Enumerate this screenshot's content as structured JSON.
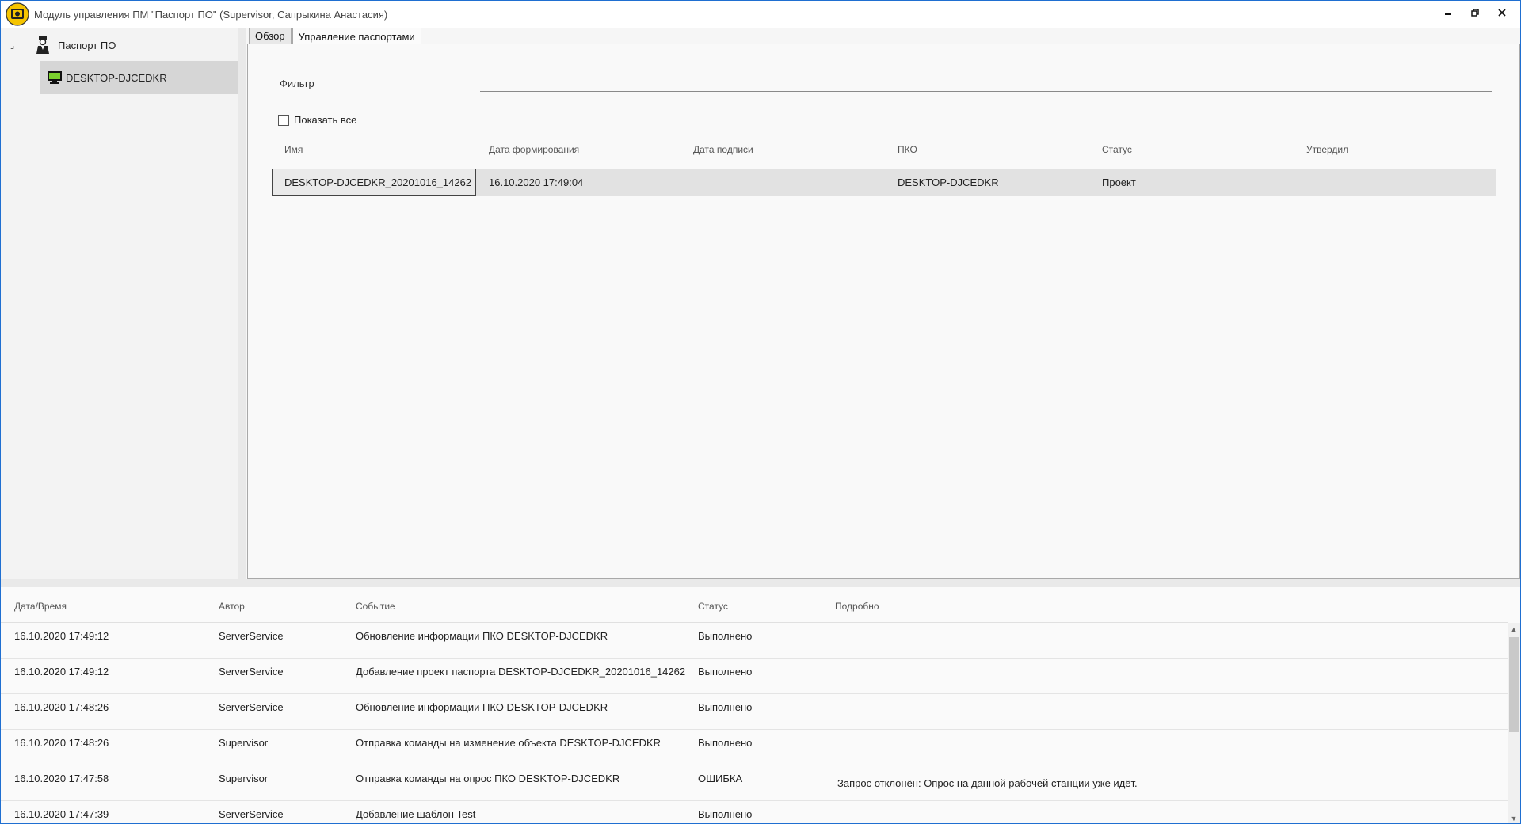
{
  "window": {
    "title": "Модуль управления ПМ \"Паспорт ПО\" (Supervisor, Сапрыкина Анастасия)"
  },
  "tree": {
    "root_label": "Паспорт ПО",
    "child_label": "DESKTOP-DJCEDKR"
  },
  "tabs": [
    {
      "label": "Обзор"
    },
    {
      "label": "Управление паспортами"
    }
  ],
  "filter": {
    "label": "Фильтр",
    "value": ""
  },
  "show_all": {
    "label": "Показать все",
    "checked": false
  },
  "passports": {
    "columns": [
      "Имя",
      "Дата формирования",
      "Дата подписи",
      "ПКО",
      "Статус",
      "Утвердил"
    ],
    "rows": [
      {
        "name": "DESKTOP-DJCEDKR_20201016_14262",
        "created": "16.10.2020 17:49:04",
        "signed": "",
        "pko": "DESKTOP-DJCEDKR",
        "status": "Проект",
        "approved_by": ""
      }
    ]
  },
  "log": {
    "columns": [
      "Дата/Время",
      "Автор",
      "Событие",
      "Статус",
      "Подробно"
    ],
    "rows": [
      {
        "datetime": "16.10.2020 17:49:12",
        "author": "ServerService",
        "event": "Обновление информации  ПКО DESKTOP-DJCEDKR",
        "status": "Выполнено",
        "details": ""
      },
      {
        "datetime": "16.10.2020 17:49:12",
        "author": "ServerService",
        "event": "Добавление проект паспорта DESKTOP-DJCEDKR_20201016_14262",
        "status": "Выполнено",
        "details": ""
      },
      {
        "datetime": "16.10.2020 17:48:26",
        "author": "ServerService",
        "event": "Обновление информации  ПКО DESKTOP-DJCEDKR",
        "status": "Выполнено",
        "details": ""
      },
      {
        "datetime": "16.10.2020 17:48:26",
        "author": "Supervisor",
        "event": "Отправка команды на изменение объекта  DESKTOP-DJCEDKR",
        "status": "Выполнено",
        "details": ""
      },
      {
        "datetime": "16.10.2020 17:47:58",
        "author": "Supervisor",
        "event": "Отправка команды на опрос ПКО  DESKTOP-DJCEDKR",
        "status": "ОШИБКА",
        "details": "Запрос отклонён: Опрос на данной рабочей станции уже идёт."
      },
      {
        "datetime": "16.10.2020 17:47:39",
        "author": "ServerService",
        "event": "Добавление шаблон Test",
        "status": "Выполнено",
        "details": ""
      }
    ]
  },
  "icons": {
    "app": "app-logo-icon",
    "user": "user-icon",
    "computer": "computer-icon",
    "minimize": "minimize-icon",
    "restore": "restore-icon",
    "close": "close-icon"
  },
  "colors": {
    "accent_border": "#1f6fd1",
    "selected_tree": "#d6d6d6",
    "computer_icon": "#7bd12e"
  }
}
